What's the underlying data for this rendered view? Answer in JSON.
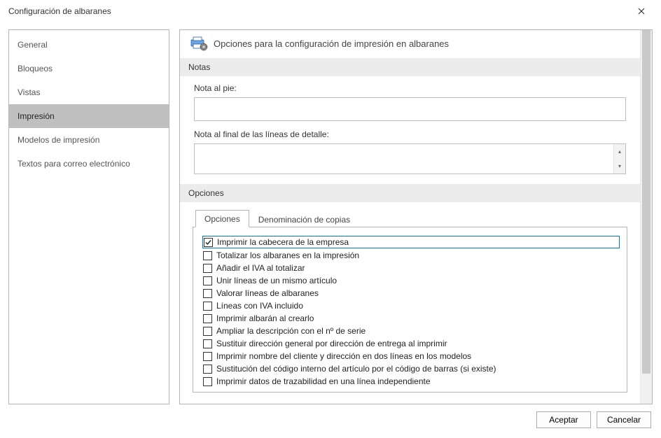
{
  "window": {
    "title": "Configuración de albaranes"
  },
  "sidebar": {
    "items": [
      {
        "label": "General"
      },
      {
        "label": "Bloqueos"
      },
      {
        "label": "Vistas"
      },
      {
        "label": "Impresión"
      },
      {
        "label": "Modelos de impresión"
      },
      {
        "label": "Textos para correo electrónico"
      }
    ],
    "selected_index": 3
  },
  "panel": {
    "title": "Opciones para la configuración de impresión en albaranes",
    "sections": {
      "notes": {
        "header": "Notas",
        "footer_note_label": "Nota al pie:",
        "footer_note_value": "",
        "detail_end_label": "Nota al final de las líneas de detalle:",
        "detail_end_value": ""
      },
      "options": {
        "header": "Opciones",
        "tabs": [
          {
            "label": "Opciones"
          },
          {
            "label": "Denominación de copias"
          }
        ],
        "active_tab": 0,
        "checkboxes": [
          {
            "label": "Imprimir la cabecera de la empresa",
            "checked": true,
            "highlight": true
          },
          {
            "label": "Totalizar los albaranes en la impresión",
            "checked": false
          },
          {
            "label": "Añadir el IVA al totalizar",
            "checked": false
          },
          {
            "label": "Unir líneas de un mismo artículo",
            "checked": false
          },
          {
            "label": "Valorar líneas de albaranes",
            "checked": false
          },
          {
            "label": "Líneas con IVA incluido",
            "checked": false
          },
          {
            "label": "Imprimir albarán al crearlo",
            "checked": false
          },
          {
            "label": "Ampliar la descripción con el nº de serie",
            "checked": false
          },
          {
            "label": "Sustituir dirección general por dirección de entrega al imprimir",
            "checked": false
          },
          {
            "label": "Imprimir nombre del cliente y dirección en dos líneas en los modelos",
            "checked": false
          },
          {
            "label": "Sustitución del código interno del artículo por el código de barras (si existe)",
            "checked": false
          },
          {
            "label": "Imprimir datos de trazabilidad en una línea independiente",
            "checked": false
          }
        ]
      }
    }
  },
  "footer": {
    "accept": "Aceptar",
    "cancel": "Cancelar"
  }
}
